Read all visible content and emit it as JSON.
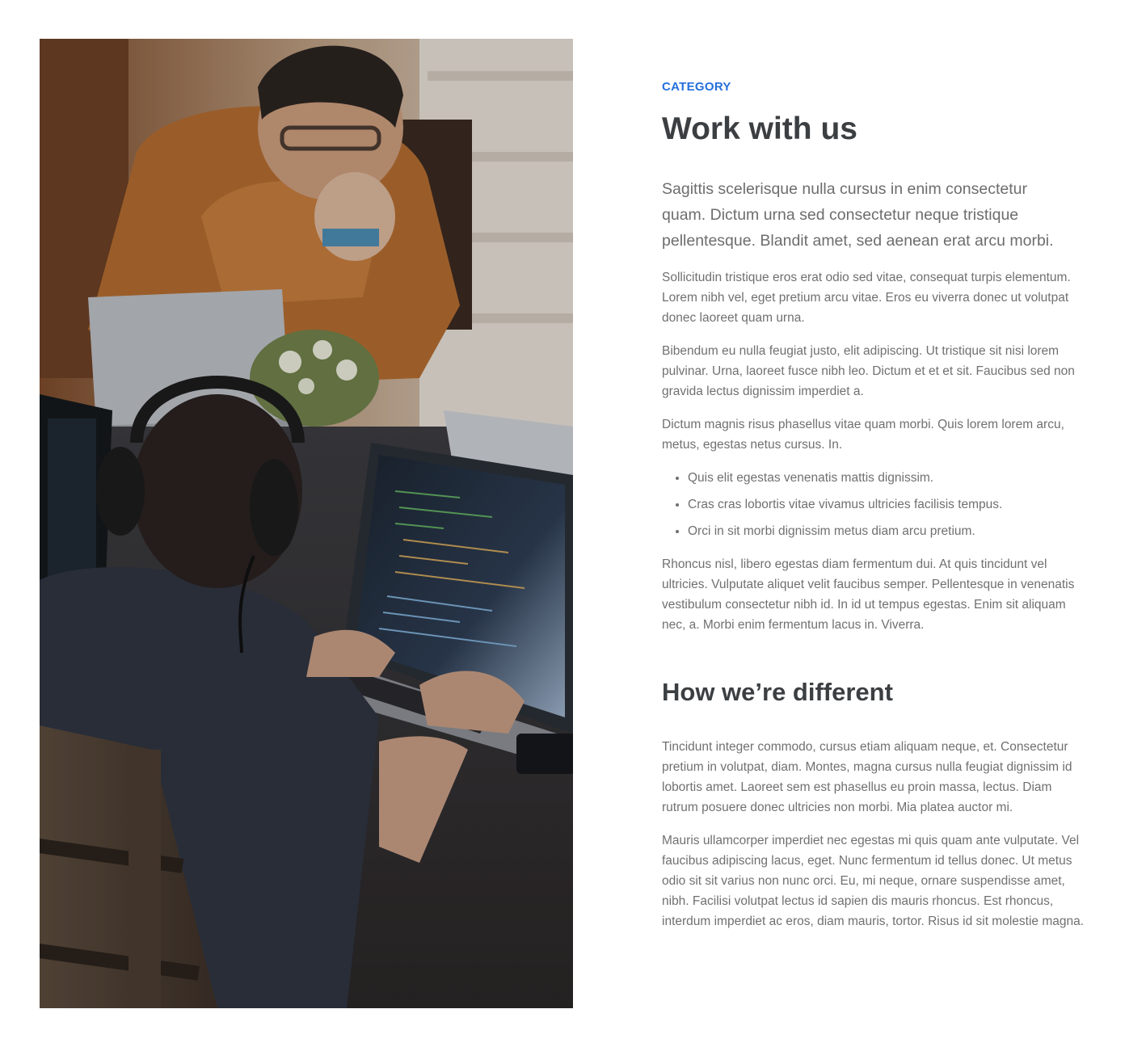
{
  "image": {
    "alt": "People working on laptops at a shared table",
    "icon": "photo"
  },
  "category_label": "CATEGORY",
  "title": "Work with us",
  "lead": "Sagittis scelerisque nulla cursus in enim consectetur quam. Dictum urna sed consectetur neque tristique pellentesque. Blandit amet, sed aenean erat arcu morbi.",
  "paragraphs": [
    "Sollicitudin tristique eros erat odio sed vitae, consequat turpis elementum. Lorem nibh vel, eget pretium arcu vitae. Eros eu viverra donec ut volutpat donec laoreet quam urna.",
    "Bibendum eu nulla feugiat justo, elit adipiscing. Ut tristique sit nisi lorem pulvinar. Urna, laoreet fusce nibh leo. Dictum et et et sit. Faucibus sed non gravida lectus dignissim imperdiet a.",
    "Dictum magnis risus phasellus vitae quam morbi. Quis lorem lorem arcu, metus, egestas netus cursus. In."
  ],
  "bullets": [
    "Quis elit egestas venenatis mattis dignissim.",
    "Cras cras lobortis vitae vivamus ultricies facilisis tempus.",
    "Orci in sit morbi dignissim metus diam arcu pretium."
  ],
  "closing_paragraph": "Rhoncus nisl, libero egestas diam fermentum dui. At quis tincidunt vel ultricies. Vulputate aliquet velit faucibus semper. Pellentesque in venenatis vestibulum consectetur nibh id. In id ut tempus egestas. Enim sit aliquam nec, a. Morbi enim fermentum lacus in. Viverra.",
  "subheading": "How we’re different",
  "different_paragraphs": [
    "Tincidunt integer commodo, cursus etiam aliquam neque, et. Consectetur pretium in volutpat, diam. Montes, magna cursus nulla feugiat dignissim id lobortis amet. Laoreet sem est phasellus eu proin massa, lectus. Diam rutrum posuere donec ultricies non morbi. Mia platea auctor mi.",
    "Mauris ullamcorper imperdiet nec egestas mi quis quam ante vulputate. Vel faucibus adipiscing lacus, eget. Nunc fermentum id tellus donec. Ut metus odio sit sit varius non nunc orci. Eu, mi neque, ornare suspendisse amet, nibh. Facilisi volutpat lectus id sapien dis mauris rhoncus. Est rhoncus, interdum imperdiet ac eros, diam mauris, tortor. Risus id sit molestie magna."
  ],
  "colors": {
    "accent": "#2470dc",
    "heading": "#3c3f42",
    "body": "#707070",
    "background": "#ffffff"
  }
}
